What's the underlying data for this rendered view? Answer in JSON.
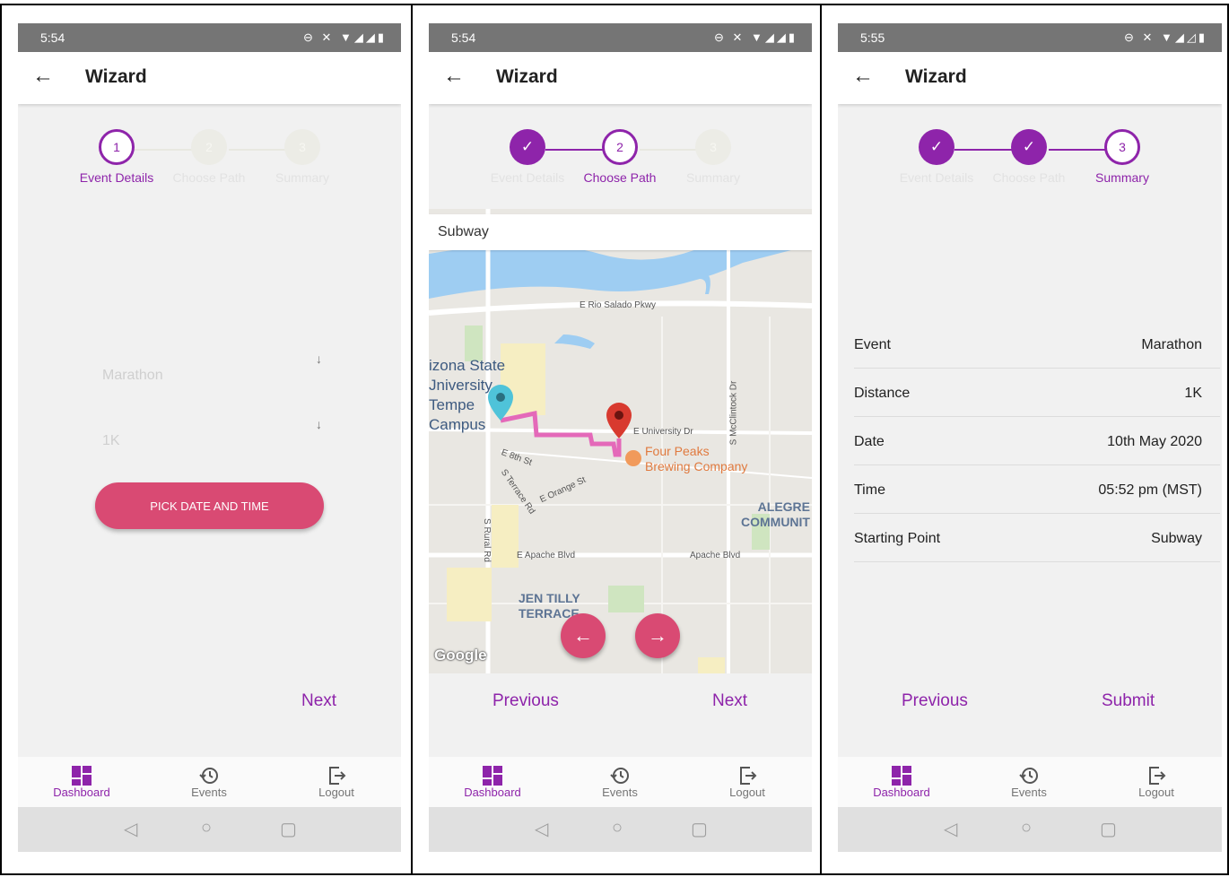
{
  "screens": [
    {
      "status_time": "5:54",
      "status_icons": "⊖ ✕ ▼◢◢▮",
      "appbar_title": "Wizard",
      "steps": [
        {
          "number": "1",
          "label": "Event Details",
          "state": "active"
        },
        {
          "number": "2",
          "label": "Choose Path",
          "state": "todo"
        },
        {
          "number": "3",
          "label": "Summary",
          "state": "todo"
        }
      ],
      "fields": {
        "event_value": "Marathon",
        "distance_value": "1K"
      },
      "pick_button": "PICK DATE AND TIME",
      "next_button": "Next"
    },
    {
      "status_time": "5:54",
      "status_icons": "⊖ ✕ ▼◢◢▮",
      "appbar_title": "Wizard",
      "steps": [
        {
          "number": "✓",
          "label": "Event Details",
          "state": "done"
        },
        {
          "number": "2",
          "label": "Choose Path",
          "state": "active"
        },
        {
          "number": "3",
          "label": "Summary",
          "state": "todo"
        }
      ],
      "search_value": "Subway",
      "map_labels": {
        "river_road": "E Rio Salado Pkwy",
        "university": "izona State\nJniversity\nTempe\nCampus",
        "univ_dr": "E University Dr",
        "mcclintock": "S McClintock Dr",
        "restaurant": "Four Peaks\nBrewing Company",
        "eighth": "E 8th St",
        "terrace": "S Terrace Rd",
        "orange": "E Orange St",
        "rural": "S Rural Rd",
        "apache_left": "E Apache Blvd",
        "apache_right": "Apache Blvd",
        "alegre": "ALEGRE\nCOMMUNIT",
        "jen_tilly": "JEN TILLY\nTERRACE",
        "google": "Google"
      },
      "previous_button": "Previous",
      "next_button": "Next"
    },
    {
      "status_time": "5:55",
      "status_icons": "⊖ ✕ ▼◢◿▮",
      "appbar_title": "Wizard",
      "steps": [
        {
          "number": "✓",
          "label": "Event Details",
          "state": "done"
        },
        {
          "number": "✓",
          "label": "Choose Path",
          "state": "done"
        },
        {
          "number": "3",
          "label": "Summary",
          "state": "active"
        }
      ],
      "summary": [
        {
          "key": "Event",
          "value": "Marathon"
        },
        {
          "key": "Distance",
          "value": "1K"
        },
        {
          "key": "Date",
          "value": "10th May 2020"
        },
        {
          "key": "Time",
          "value": "05:52 pm (MST)"
        },
        {
          "key": "Starting Point",
          "value": "Subway"
        }
      ],
      "previous_button": "Previous",
      "submit_button": "Submit"
    }
  ],
  "bottom_nav": [
    {
      "label": "Dashboard",
      "icon": "dashboard-icon"
    },
    {
      "label": "Events",
      "icon": "history-icon"
    },
    {
      "label": "Logout",
      "icon": "logout-icon"
    }
  ],
  "colors": {
    "accent": "#8e24aa",
    "button": "#d94a73",
    "background": "#f1f1f1"
  }
}
